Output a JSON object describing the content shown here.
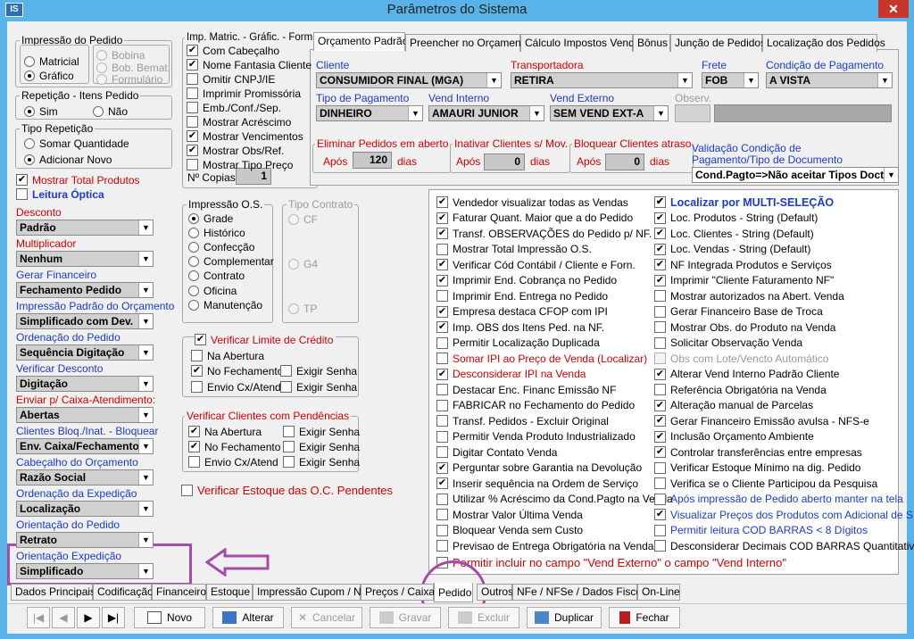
{
  "window": {
    "title": "Parâmetros do Sistema",
    "icon": "IS",
    "close": "✕"
  },
  "impressao_pedido": {
    "legend": "Impressão do Pedido",
    "matricial": "Matricial",
    "grafico": "Gráfico",
    "bobina": "Bobina",
    "bob_bemat": "Bob. Bemat.",
    "formulario": "Formulário",
    "selected": "Gráfico"
  },
  "repeticao": {
    "legend": "Repetição - Itens Pedido",
    "sim": "Sim",
    "nao": "Não",
    "selected": "Sim"
  },
  "tipo_repeticao": {
    "legend": "Tipo Repetição",
    "somar": "Somar Quantidade",
    "adicionar": "Adicionar Novo",
    "selected": "Adicionar Novo"
  },
  "left_checks": {
    "mostrar_total": "Mostrar Total Produtos",
    "leitura_optica": "Leitura Óptica"
  },
  "left_combos": [
    {
      "label": "Desconto",
      "value": "Padrão"
    },
    {
      "label": "Multiplicador",
      "value": "Nenhum"
    },
    {
      "label": "Gerar Financeiro",
      "value": "Fechamento Pedido"
    },
    {
      "label": "Impressão Padrão do Orçamento",
      "value": "Simplificado com Dev."
    },
    {
      "label": "Ordenação do Pedido",
      "value": "Sequência Digitação"
    },
    {
      "label": "Verificar Desconto",
      "value": "Digitação"
    },
    {
      "label": "Enviar p/ Caixa-Atendimento:",
      "value": "Abertas"
    },
    {
      "label": "Clientes Bloq./Inat. - Bloquear",
      "value": "Env. Caixa/Fechamento"
    },
    {
      "label": "Cabeçalho do Orçamento",
      "value": "Razão Social"
    },
    {
      "label": "Ordenação da Expedição",
      "value": "Localização"
    },
    {
      "label": "Orientação do Pedido",
      "value": "Retrato"
    },
    {
      "label": "Orientação Expedição",
      "value": "Simplificado"
    }
  ],
  "imp_matric": {
    "legend": "Imp. Matric. - Gráfic. - Form.",
    "items": [
      {
        "label": "Com Cabeçalho",
        "checked": "✔"
      },
      {
        "label": "Nome Fantasia Cliente",
        "checked": "✔"
      },
      {
        "label": "Omitir CNPJ/IE",
        "checked": ""
      },
      {
        "label": "Imprimir Promissória",
        "checked": ""
      },
      {
        "label": "Emb./Conf./Sep.",
        "checked": ""
      },
      {
        "label": "Mostrar Acréscimo",
        "checked": ""
      },
      {
        "label": "Mostrar Vencimentos",
        "checked": "✔"
      },
      {
        "label": "Mostrar Obs/Ref.",
        "checked": "✔"
      },
      {
        "label": "Mostrar Tipo Preço",
        "checked": ""
      }
    ],
    "copias_label": "Nº Copias",
    "copias_value": "1"
  },
  "impressao_os": {
    "legend": "Impressão O.S.",
    "options": [
      "Grade",
      "Histórico",
      "Confecção",
      "Complementar",
      "Contrato",
      "Oficina",
      "Manutenção"
    ],
    "selected": "Grade"
  },
  "tipo_contrato": {
    "legend": "Tipo Contrato",
    "cf": "CF",
    "g4": "G4",
    "tp": "TP"
  },
  "verificar_credito": {
    "legend": "Verificar Limite de Crédito",
    "checked": "✔",
    "na_abertura": "Na Abertura",
    "no_fechamento": "No Fechamento",
    "envio": "Envio Cx/Atend",
    "exigir1": "Exigir Senha",
    "exigir2": "Exigir Senha"
  },
  "verificar_pendencias": {
    "legend": "Verificar Clientes com Pendências",
    "na_abertura": "Na Abertura",
    "no_fechamento": "No Fechamento",
    "envio": "Envio Cx/Atend",
    "exigir1": "Exigir Senha",
    "exigir2": "Exigir Senha",
    "exigir3": "Exigir Senha"
  },
  "verificar_estoque": "Verificar Estoque das O.C. Pendentes",
  "top_tabs": [
    "Orçamento Padrão",
    "Preencher no Orçamento",
    "Cálculo Impostos Venda",
    "Bônus",
    "Junção de Pedidos",
    "Localização dos Pedidos"
  ],
  "orc": {
    "cliente": {
      "label": "Cliente",
      "value": "CONSUMIDOR FINAL (MGA)"
    },
    "transportadora": {
      "label": "Transportadora",
      "value": "RETIRA"
    },
    "frete": {
      "label": "Frete",
      "value": "FOB"
    },
    "condicao": {
      "label": "Condição de Pagamento",
      "value": "A VISTA"
    },
    "tipo_pagamento": {
      "label": "Tipo de Pagamento",
      "value": "DINHEIRO"
    },
    "vend_interno": {
      "label": "Vend Interno",
      "value": "AMAURI JUNIOR"
    },
    "vend_externo": {
      "label": "Vend Externo",
      "value": "SEM VEND EXT-A"
    },
    "observ": {
      "label": "Observ."
    },
    "eliminar": {
      "legend": "Eliminar Pedidos em aberto",
      "apos": "Após",
      "value": "120",
      "dias": "dias"
    },
    "inativar": {
      "legend": "Inativar Clientes s/ Mov.",
      "apos": "Após",
      "value": "0",
      "dias": "dias"
    },
    "bloquear": {
      "legend": "Bloquear Clientes atraso",
      "apos": "Após",
      "value": "0",
      "dias": "dias"
    },
    "validacao": {
      "label1": "Validação Condição de",
      "label2": "Pagamento/Tipo de Documento",
      "value": "Cond.Pagto=>Não aceitar Tipos Docto"
    }
  },
  "opts_left": [
    {
      "label": "Vendedor visualizar todas as Vendas",
      "checked": "✔",
      "style": "normal"
    },
    {
      "label": "Faturar Quant. Maior que a do Pedido",
      "checked": "✔",
      "style": "normal"
    },
    {
      "label": "Transf. OBSERVAÇÕES do Pedido p/ NF.",
      "checked": "✔",
      "style": "normal"
    },
    {
      "label": "Mostrar Total Impressão O.S.",
      "checked": "",
      "style": "normal"
    },
    {
      "label": "Verificar Cód Contábil / Cliente e Forn.",
      "checked": "✔",
      "style": "normal"
    },
    {
      "label": "Imprimir End. Cobrança no Pedido",
      "checked": "✔",
      "style": "normal"
    },
    {
      "label": "Imprimir End. Entrega no Pedido",
      "checked": "",
      "style": "normal"
    },
    {
      "label": "Empresa destaca CFOP com IPI",
      "checked": "✔",
      "style": "normal"
    },
    {
      "label": "Imp. OBS dos Itens Ped. na NF.",
      "checked": "✔",
      "style": "normal"
    },
    {
      "label": "Permitir Localização Duplicada",
      "checked": "",
      "style": "normal"
    },
    {
      "label": "Somar IPI ao Preço de Venda (Localizar)",
      "checked": "",
      "style": "red"
    },
    {
      "label": "Desconsiderar IPI na Venda",
      "checked": "✔",
      "style": "red"
    },
    {
      "label": "Destacar Enc. Financ Emissão NF",
      "checked": "",
      "style": "normal"
    },
    {
      "label": "FABRICAR no Fechamento do Pedido",
      "checked": "",
      "style": "normal"
    },
    {
      "label": "Transf. Pedidos - Excluir Original",
      "checked": "",
      "style": "normal"
    },
    {
      "label": "Permitir Venda Produto Industrializado",
      "checked": "",
      "style": "normal"
    },
    {
      "label": "Digitar Contato Venda",
      "checked": "",
      "style": "normal"
    },
    {
      "label": "Perguntar sobre Garantia na Devolução",
      "checked": "✔",
      "style": "normal"
    },
    {
      "label": "Inserir sequência na Ordem de Serviço",
      "checked": "✔",
      "style": "normal"
    },
    {
      "label": "Utilizar % Acréscimo da Cond.Pagto na Venda",
      "checked": "",
      "style": "normal"
    },
    {
      "label": "Mostrar Valor Última Venda",
      "checked": "",
      "style": "normal"
    },
    {
      "label": "Bloquear Venda sem Custo",
      "checked": "",
      "style": "normal"
    },
    {
      "label": "Previsao de Entrega Obrigatória na Venda",
      "checked": "",
      "style": "normal"
    }
  ],
  "opts_right": [
    {
      "label": "Localizar por MULTI-SELEÇÃO",
      "checked": "✔",
      "style": "bluebold"
    },
    {
      "label": "Loc. Produtos - String (Default)",
      "checked": "✔",
      "style": "normal"
    },
    {
      "label": "Loc. Clientes - String (Default)",
      "checked": "✔",
      "style": "normal"
    },
    {
      "label": "Loc. Vendas - String (Default)",
      "checked": "✔",
      "style": "normal"
    },
    {
      "label": "NF Integrada Produtos e Serviços",
      "checked": "✔",
      "style": "normal"
    },
    {
      "label": "Imprimir \"Cliente Faturamento NF\"",
      "checked": "✔",
      "style": "normal"
    },
    {
      "label": "Mostrar autorizados na Abert. Venda",
      "checked": "",
      "style": "normal"
    },
    {
      "label": "Gerar Financeiro Base de Troca",
      "checked": "",
      "style": "normal"
    },
    {
      "label": "Mostrar Obs. do Produto na Venda",
      "checked": "",
      "style": "normal"
    },
    {
      "label": "Solicitar Observação Venda",
      "checked": "",
      "style": "normal"
    },
    {
      "label": "Obs com Lote/Vencto Automático",
      "checked": "",
      "style": "gray"
    },
    {
      "label": "Alterar Vend Interno Padrão Cliente",
      "checked": "✔",
      "style": "normal"
    },
    {
      "label": "Referência Obrigatória na Venda",
      "checked": "",
      "style": "normal"
    },
    {
      "label": "Alteração manual de Parcelas",
      "checked": "✔",
      "style": "normal"
    },
    {
      "label": "Gerar Financeiro Emissão avulsa - NFS-e",
      "checked": "✔",
      "style": "normal"
    },
    {
      "label": "Inclusão Orçamento Ambiente",
      "checked": "✔",
      "style": "normal"
    },
    {
      "label": "Controlar transferências entre empresas",
      "checked": "✔",
      "style": "normal"
    },
    {
      "label": "Verificar Estoque Mínimo na dig. Pedido",
      "checked": "",
      "style": "normal"
    },
    {
      "label": "Verifica se o Cliente Participou da Pesquisa",
      "checked": "",
      "style": "normal"
    },
    {
      "label": "Após impressão de Pedido aberto manter na tela",
      "checked": "",
      "style": "blue"
    },
    {
      "label": "Visualizar Preços dos Produtos com Adicional de S.T.",
      "checked": "✔",
      "style": "blue"
    },
    {
      "label": "Permitir leitura COD BARRAS < 8 Dígitos",
      "checked": "",
      "style": "blue"
    },
    {
      "label": "Desconsiderar Decimais COD BARRAS Quantitativo",
      "checked": "",
      "style": "normal"
    }
  ],
  "permitir_vend": "Permitir incluir no campo \"Vend Externo\" o campo \"Vend Interno\"",
  "bottom_tabs": [
    "Dados Principais",
    "Codificação",
    "Financeiro",
    "Estoque",
    "Impressão Cupom / NF",
    "Preços / Caixa",
    "Pedido",
    "Outros",
    "NFe / NFSe / Dados Fisco",
    "On-Line"
  ],
  "active_bottom_tab": "Pedido",
  "nav": {
    "first": "|◀",
    "prev": "◀",
    "next": "▶",
    "last": "▶|"
  },
  "actions": {
    "novo": "Novo",
    "alterar": "Alterar",
    "cancelar": "Cancelar",
    "gravar": "Gravar",
    "excluir": "Excluir",
    "duplicar": "Duplicar",
    "fechar": "Fechar"
  },
  "colors": {
    "annotation": "#a64ca6",
    "red_label": "#d60000",
    "blue_label": "#1a3bd0",
    "titlebar": "#59b3e8"
  }
}
